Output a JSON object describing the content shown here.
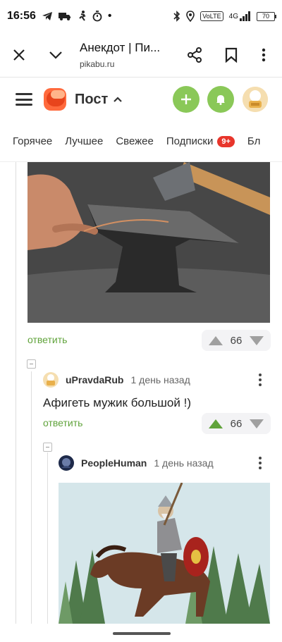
{
  "status_bar": {
    "time": "16:56",
    "volte": "VoLTE",
    "network": "4G",
    "battery": "70"
  },
  "browser": {
    "title": "Анекдот | Пи...",
    "url": "pikabu.ru"
  },
  "site_header": {
    "title": "Пост"
  },
  "category_tabs": [
    {
      "label": "Горячее"
    },
    {
      "label": "Лучшее"
    },
    {
      "label": "Свежее"
    },
    {
      "label": "Подписки",
      "badge": "9+"
    },
    {
      "label": "Бл"
    }
  ],
  "post": {
    "reply_label": "ответить",
    "votes": "66"
  },
  "comments": [
    {
      "author": "uPravdaRub",
      "time": "1 день назад",
      "text": "Афигеть мужик большой !)",
      "reply_label": "ответить",
      "votes": "66",
      "upvoted": true
    },
    {
      "author": "PeopleHuman",
      "time": "1 день назад"
    }
  ],
  "colors": {
    "accent_green": "#8ac858",
    "reply_green": "#60a33b",
    "badge_red": "#e8352b"
  }
}
